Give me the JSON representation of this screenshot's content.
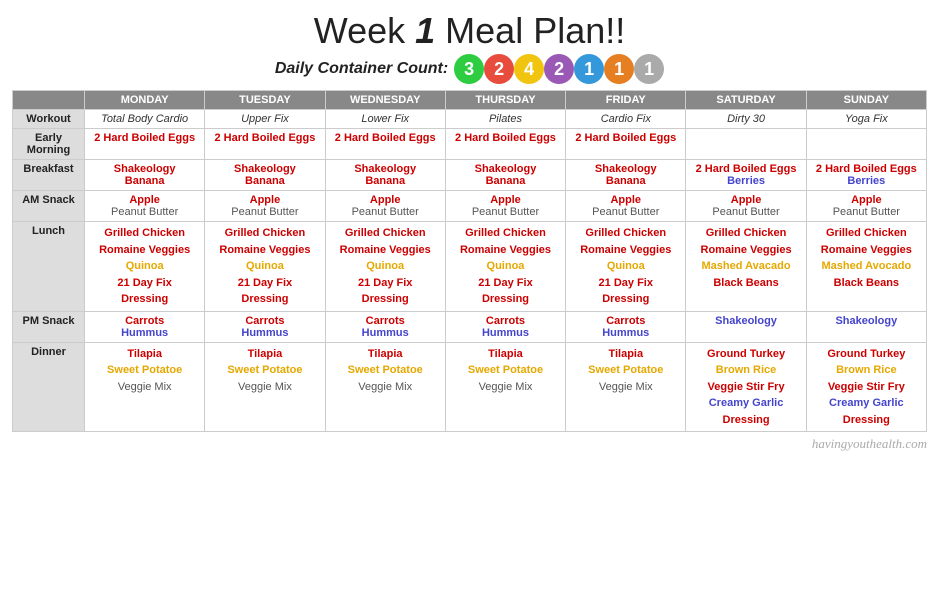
{
  "header": {
    "title_prefix": "Week ",
    "title_num": "1",
    "title_suffix": " Meal Plan!!",
    "subtitle": "Daily Container Count:",
    "badges": [
      {
        "label": "3",
        "color": "#2ecc40"
      },
      {
        "label": "2",
        "color": "#e74c3c"
      },
      {
        "label": "4",
        "color": "#f1c40f"
      },
      {
        "label": "2",
        "color": "#9b59b6"
      },
      {
        "label": "1",
        "color": "#3498db"
      },
      {
        "label": "1",
        "color": "#e67e22"
      },
      {
        "label": "1",
        "color": "#aaa"
      }
    ]
  },
  "days": [
    "Monday",
    "Tuesday",
    "Wednesday",
    "Thursday",
    "Friday",
    "Saturday",
    "Sunday"
  ],
  "rows": {
    "workout": [
      "Total Body Cardio",
      "Upper Fix",
      "Lower Fix",
      "Pilates",
      "Cardio Fix",
      "Dirty 30",
      "Yoga Fix"
    ],
    "early_morning": [
      "2 Hard Boiled Eggs",
      "2 Hard Boiled Eggs",
      "2 Hard Boiled Eggs",
      "2 Hard Boiled Eggs",
      "2 Hard Boiled Eggs",
      "",
      ""
    ],
    "breakfast_line1": [
      "Shakeology",
      "Shakeology",
      "Shakeology",
      "Shakeology",
      "Shakeology",
      "2 Hard Boiled Eggs",
      "2 Hard Boiled Eggs"
    ],
    "breakfast_line2": [
      "Banana",
      "Banana",
      "Banana",
      "Banana",
      "Banana",
      "Berries",
      "Berries"
    ],
    "am_snack_line1": [
      "Apple",
      "Apple",
      "Apple",
      "Apple",
      "Apple",
      "Apple",
      "Apple"
    ],
    "am_snack_line2": [
      "Peanut Butter",
      "Peanut Butter",
      "Peanut Butter",
      "Peanut Butter",
      "Peanut Butter",
      "Peanut Butter",
      "Peanut Butter"
    ],
    "lunch_mon_fri": {
      "line1": "Grilled Chicken",
      "line2": "Romaine Veggies",
      "line3": "Quinoa",
      "line4": "21 Day Fix",
      "line5": "Dressing"
    },
    "lunch_sat": {
      "line1": "Grilled Chicken",
      "line2": "Romaine Veggies",
      "line3": "Mashed Avacado",
      "line4": "Black Beans"
    },
    "lunch_sun": {
      "line1": "Grilled Chicken",
      "line2": "Romaine Veggies",
      "line3": "Mashed Avocado",
      "line4": "Black Beans"
    },
    "pm_snack_mon_fri": {
      "line1": "Carrots",
      "line2": "Hummus"
    },
    "pm_snack_sat_sun": "Shakeology",
    "dinner_mon_fri": {
      "line1": "Tilapia",
      "line2": "Sweet Potatoe",
      "line3": "Veggie Mix"
    },
    "dinner_sat": {
      "line1": "Ground Turkey",
      "line2": "Brown Rice",
      "line3": "Veggie Stir Fry",
      "line4": "Creamy Garlic",
      "line5": "Dressing"
    },
    "dinner_sun": {
      "line1": "Ground Turkey",
      "line2": "Brown Rice",
      "line3": "Veggie Stir Fry",
      "line4": "Creamy Garlic",
      "line5": "Dressing"
    }
  },
  "watermark": "havingyouthealth.com"
}
